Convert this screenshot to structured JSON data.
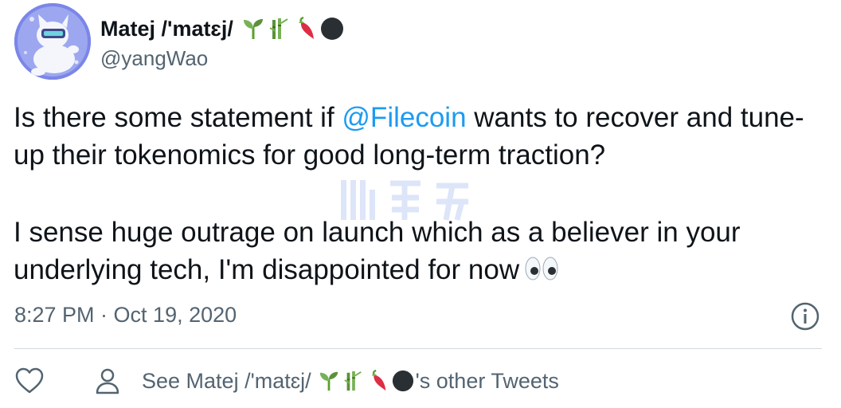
{
  "author": {
    "name": "Matej /'matɛj/",
    "handle": "@yangWao",
    "name_emojis": [
      "seedling",
      "bamboo",
      "hot-pepper",
      "black-circle"
    ]
  },
  "tweet": {
    "line1_before": "Is there some statement if ",
    "mention": "@Filecoin",
    "line1_after": " wants to recover and tune-up their tokenomics for good long-term traction?",
    "paragraph2": "I sense huge outrage on launch which as a believer in your underlying tech, I'm disappointed for now",
    "trailing_emoji": "eyes"
  },
  "meta": {
    "timestamp": "8:27 PM · Oct 19, 2020"
  },
  "actions": {
    "other_tweets_prefix": "See Matej /'matɛj/",
    "other_tweets_suffix": "'s other Tweets"
  },
  "colors": {
    "link": "#1d9bf0",
    "secondary_text": "#536471",
    "divider": "#cfd9de",
    "avatar_bg": "#7b86e8"
  }
}
